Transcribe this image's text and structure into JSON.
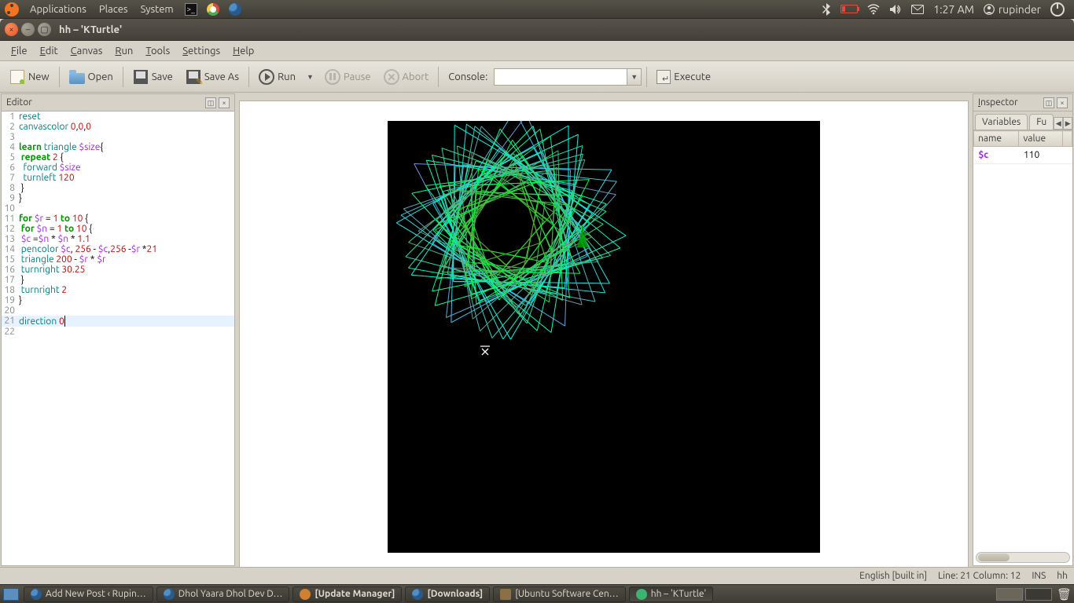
{
  "gnome": {
    "menus": [
      "Applications",
      "Places",
      "System"
    ],
    "time": "1:27 AM",
    "user": "rupinder"
  },
  "window": {
    "title": "hh – 'KTurtle'"
  },
  "menubar": {
    "file": "File",
    "edit": "Edit",
    "canvas": "Canvas",
    "run": "Run",
    "tools": "Tools",
    "settings": "Settings",
    "help": "Help"
  },
  "toolbar": {
    "new": "New",
    "open": "Open",
    "save": "Save",
    "save_as": "Save As",
    "run": "Run",
    "pause": "Pause",
    "abort": "Abort",
    "console_label": "Console:",
    "execute": "Execute"
  },
  "editor": {
    "title": "Editor",
    "lines": [
      {
        "n": 1,
        "html": "<span class='func'>reset</span>"
      },
      {
        "n": 2,
        "html": "<span class='func'>canvascolor</span> <span class='num'>0</span>,<span class='num'>0</span>,<span class='num'>0</span>"
      },
      {
        "n": 3,
        "html": ""
      },
      {
        "n": 4,
        "html": "<span class='kw'>learn</span> <span class='func'>triangle</span> <span class='var'>$size</span>{"
      },
      {
        "n": 5,
        "html": " <span class='kw'>repeat</span> <span class='num'>2</span> {"
      },
      {
        "n": 6,
        "html": "  <span class='func'>forward</span> <span class='var'>$size</span>"
      },
      {
        "n": 7,
        "html": "  <span class='func'>turnleft</span> <span class='num'>120</span>"
      },
      {
        "n": 8,
        "html": " }"
      },
      {
        "n": 9,
        "html": "}"
      },
      {
        "n": 10,
        "html": ""
      },
      {
        "n": 11,
        "html": "<span class='kw'>for</span> <span class='var'>$r</span> = <span class='num'>1</span> <span class='kw'>to</span> <span class='num'>10</span> {"
      },
      {
        "n": 12,
        "html": " <span class='kw'>for</span> <span class='var'>$n</span> = <span class='num'>1</span> <span class='kw'>to</span> <span class='num'>10</span> {"
      },
      {
        "n": 13,
        "html": " <span class='var'>$c</span> =<span class='var'>$n</span> * <span class='var'>$n</span> * <span class='num'>1.1</span>"
      },
      {
        "n": 14,
        "html": " <span class='func'>pencolor</span> <span class='var'>$c</span>, <span class='num'>256</span> - <span class='var'>$c</span>,<span class='num'>256</span> -<span class='var'>$r</span> *<span class='num'>21</span>"
      },
      {
        "n": 15,
        "html": " <span class='func'>triangle</span> <span class='num'>200</span> - <span class='var'>$r</span> * <span class='var'>$r</span>"
      },
      {
        "n": 16,
        "html": " <span class='func'>turnright</span> <span class='num'>30.25</span>"
      },
      {
        "n": 17,
        "html": " }"
      },
      {
        "n": 18,
        "html": " <span class='func'>turnright</span> <span class='num'>2</span>"
      },
      {
        "n": 19,
        "html": "}"
      },
      {
        "n": 20,
        "html": ""
      },
      {
        "n": 21,
        "html": "<span class='func'>direction</span> <span class='num'>0</span><span class='cursor'></span>",
        "current": true
      },
      {
        "n": 22,
        "html": ""
      }
    ]
  },
  "inspector": {
    "title": "Inspector",
    "tab_vars": "Variables",
    "tab_funcs": "Fu",
    "col_name": "name",
    "col_value": "value",
    "rows": [
      {
        "name": "$c",
        "value": "110"
      }
    ]
  },
  "statusbar": {
    "lang": "English [built in]",
    "line_label": "Line:",
    "line": "21",
    "col_label": "Column:",
    "col": "12",
    "ins": "INS",
    "file": "hh"
  },
  "taskbar": {
    "tasks": [
      {
        "label": "Add New Post ‹ Rupin…",
        "icon": "ff"
      },
      {
        "label": "Dhol Yaara Dhol Dev D…",
        "icon": "ff"
      },
      {
        "label": "[Update Manager]",
        "icon": "upd",
        "bold": true
      },
      {
        "label": "[Downloads]",
        "icon": "ff",
        "bold": true
      },
      {
        "label": "[Ubuntu Software Cen…",
        "icon": "sw"
      },
      {
        "label": "hh – 'KTurtle'",
        "icon": "kt",
        "active": true
      }
    ]
  }
}
